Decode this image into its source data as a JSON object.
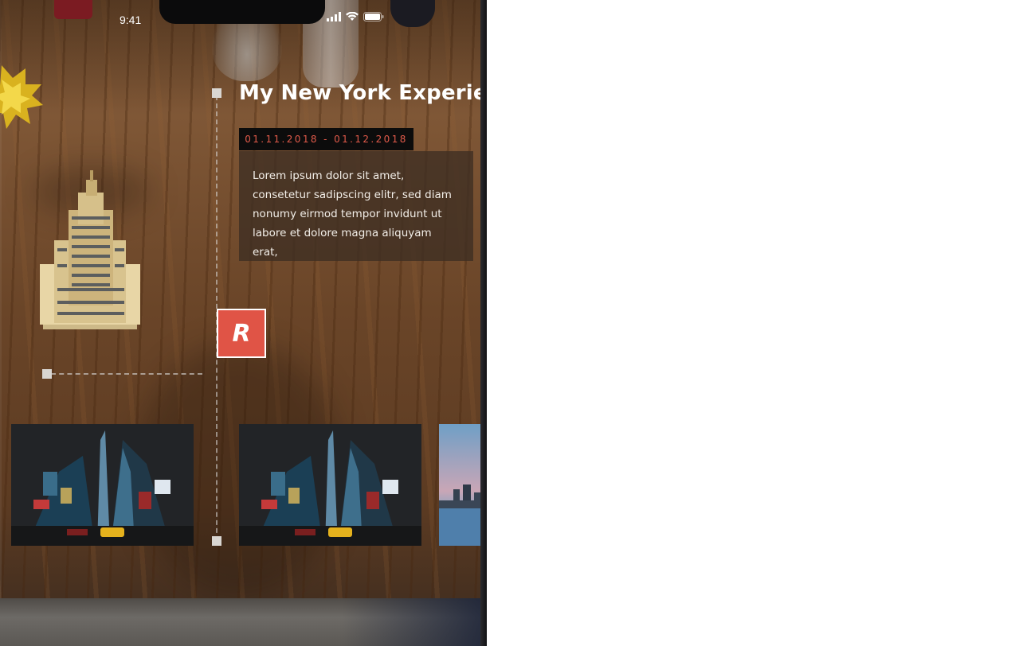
{
  "status_bar": {
    "time": "9:41",
    "icons": [
      "signal-icon",
      "wifi-icon",
      "battery-icon"
    ]
  },
  "experience": {
    "title": "My New York Experience",
    "date_range": "01.11.2018 - 01.12.2018",
    "description": "Lorem ipsum dolor sit amet, consetetur sadipscing elitr, sed diam nonumy eirmod tempor invidunt ut labore et dolore magna aliquyam erat,"
  },
  "logo": {
    "letter": "R"
  },
  "gallery": {
    "items": [
      {
        "subject": "times-square-night-photo"
      },
      {
        "subject": "times-square-night-photo"
      },
      {
        "subject": "skyline-dusk-photo"
      }
    ]
  },
  "colors": {
    "accent": "#e05446",
    "date_text": "#e15a4a",
    "badge_bg": "#0c0c0c",
    "text": "#ffffff"
  }
}
